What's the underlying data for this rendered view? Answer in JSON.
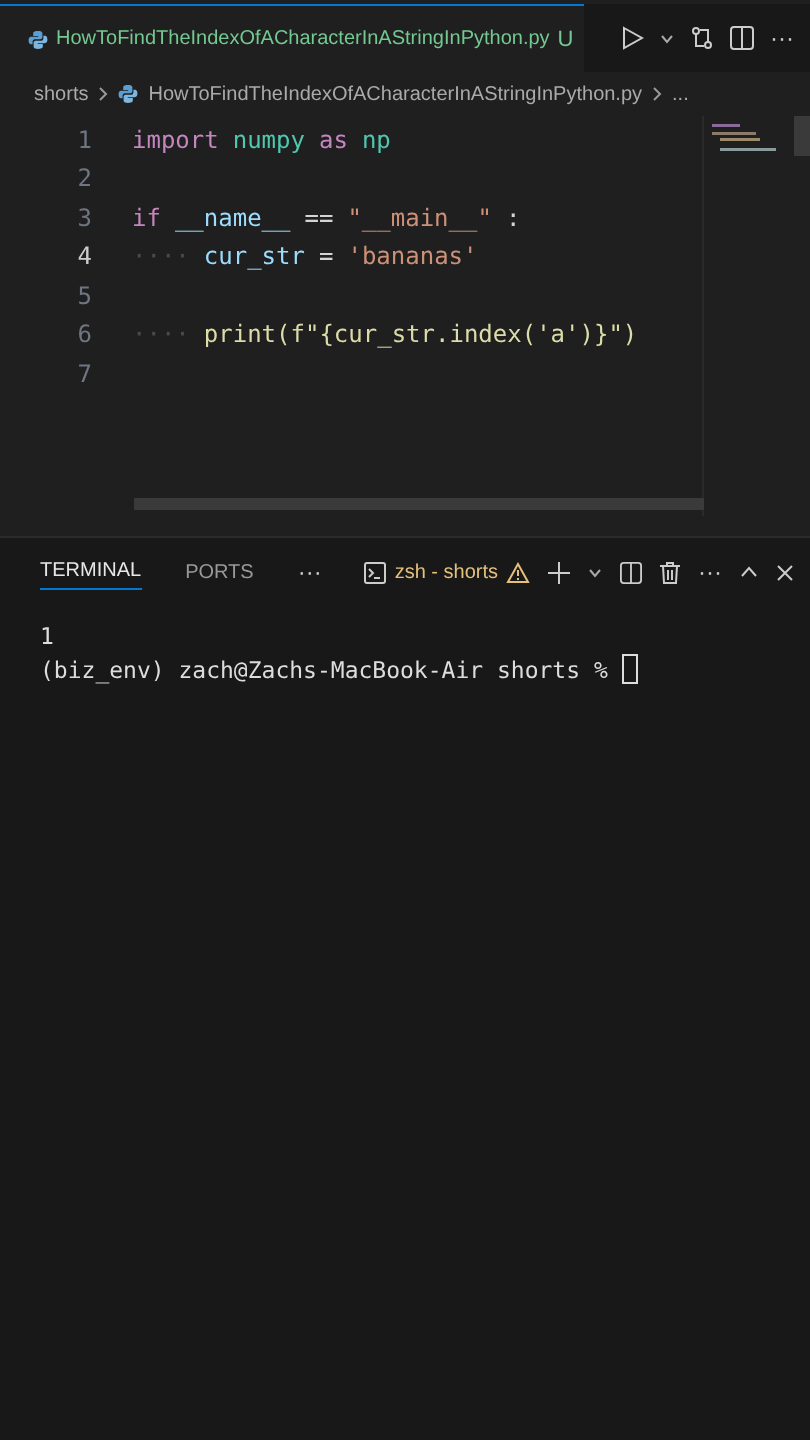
{
  "editor_tab": {
    "filename": "HowToFindTheIndexOfACharacterInAStringInPython.py",
    "status": "U"
  },
  "editor_actions": {
    "more": "···"
  },
  "breadcrumb": {
    "folder": "shorts",
    "file": "HowToFindTheIndexOfACharacterInAStringInPython.py",
    "more": "..."
  },
  "code_lines": [
    {
      "number": "1",
      "active": false,
      "tokens": [
        {
          "kind": "keyword",
          "text": "import"
        },
        {
          "kind": "module",
          "text": "numpy"
        },
        {
          "kind": "keyword",
          "text": "as"
        },
        {
          "kind": "module",
          "text": "np"
        }
      ]
    },
    {
      "number": "2",
      "active": false
    },
    {
      "number": "3",
      "active": false,
      "tokens": [
        {
          "kind": "keyword",
          "text": "if"
        },
        {
          "kind": "var",
          "text": "__name__"
        },
        {
          "kind": "op",
          "text": "=="
        },
        {
          "kind": "string",
          "text": "\"__main__\""
        },
        {
          "kind": "op",
          "text": ":"
        }
      ]
    },
    {
      "number": "4",
      "active": true,
      "tokens": [
        {
          "kind": "ws",
          "text": "····"
        },
        {
          "kind": "var",
          "text": "cur_str"
        },
        {
          "kind": "op",
          "text": "="
        },
        {
          "kind": "string",
          "text": "'bananas'"
        }
      ]
    },
    {
      "number": "5",
      "active": false
    },
    {
      "number": "6",
      "active": false,
      "tokens": [
        {
          "kind": "ws",
          "text": "····"
        },
        {
          "kind": "func",
          "text": "print(f\"{cur_str.index('a')}\")"
        }
      ]
    },
    {
      "number": "7",
      "active": false
    }
  ],
  "panel_tabs": [
    {
      "label": "TERMINAL",
      "selected": true
    },
    {
      "label": "PORTS",
      "selected": false
    }
  ],
  "panel_more": "···",
  "terminal_name": "zsh - shorts",
  "panel_actions_more": "···",
  "terminal_lines": [
    "1",
    "(biz_env) zach@Zachs-MacBook-Air shorts % "
  ]
}
